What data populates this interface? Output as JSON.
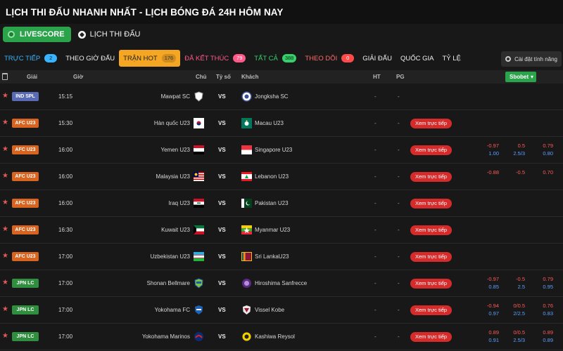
{
  "page": {
    "title": "LỊCH THI ĐẤU NHANH NHẤT - LỊCH BÓNG ĐÁ 24H HÔM NAY"
  },
  "modes": {
    "livescore": "LIVESCORE",
    "schedule": "LỊCH THI ĐẤU"
  },
  "filters": {
    "live": {
      "label": "TRỰC TIẾP",
      "count": "2"
    },
    "by_time": {
      "label": "THEO GIỜ ĐẤU"
    },
    "hot": {
      "label": "TRẬN HOT",
      "count": "176"
    },
    "finished": {
      "label": "ĐÃ KẾT THÚC",
      "count": "79"
    },
    "all": {
      "label": "TẤT CẢ",
      "count": "388"
    },
    "following": {
      "label": "THEO DÕI",
      "count": "0"
    },
    "league": {
      "label": "GIẢI ĐẤU"
    },
    "country": {
      "label": "QUỐC GIA"
    },
    "odds": {
      "label": "TỶ LỆ"
    },
    "settings": {
      "label": "Cài đặt tính năng"
    }
  },
  "table_header": {
    "league": "Giải",
    "time": "Giờ",
    "home": "Chủ",
    "score": "Tỷ số",
    "away": "Khách",
    "ht": "HT",
    "pg": "PG",
    "bookmaker": "Sbobet"
  },
  "live_button_label": "Xem trực tiếp",
  "colors": {
    "accent_green": "#2aa34a",
    "hot_orange": "#f5a623",
    "live_red": "#d62b2b",
    "odds_red": "#ff5a5a",
    "odds_blue": "#5aa0ff"
  },
  "matches": [
    {
      "league": "IND SPL",
      "league_color": "#5a6bb5",
      "time": "15:15",
      "home": "Mawpat SC",
      "home_logo": "shield-icon",
      "vs": "VS",
      "away": "Jongksha SC",
      "away_logo": "club-crest-icon",
      "ht": "-",
      "pg": "-",
      "live": false,
      "odds": null
    },
    {
      "league": "AFC U23",
      "league_color": "#d9641f",
      "time": "15:30",
      "home": "Hàn quốc U23",
      "home_logo": "korea-flag-icon",
      "vs": "VS",
      "away": "Macau U23",
      "away_logo": "macau-flag-icon",
      "ht": "-",
      "pg": "-",
      "live": true,
      "odds": null
    },
    {
      "league": "AFC U23",
      "league_color": "#d9641f",
      "time": "16:00",
      "home": "Yemen U23",
      "home_logo": "yemen-flag-icon",
      "vs": "VS",
      "away": "Singapore U23",
      "away_logo": "singapore-flag-icon",
      "ht": "-",
      "pg": "-",
      "live": true,
      "odds": {
        "a1": "-0.97",
        "a2": "1.00",
        "b1": "0.5",
        "b2": "2.5/3",
        "c1": "0.79",
        "c2": "0.80"
      }
    },
    {
      "league": "AFC U23",
      "league_color": "#d9641f",
      "time": "16:00",
      "home": "Malaysia U23",
      "home_logo": "malaysia-flag-icon",
      "vs": "VS",
      "away": "Lebanon U23",
      "away_logo": "lebanon-flag-icon",
      "ht": "-",
      "pg": "-",
      "live": true,
      "odds": {
        "a1": "-0.88",
        "a2": "",
        "b1": "-0.5",
        "b2": "",
        "c1": "0.70",
        "c2": ""
      }
    },
    {
      "league": "AFC U23",
      "league_color": "#d9641f",
      "time": "16:00",
      "home": "Iraq U23",
      "home_logo": "iraq-flag-icon",
      "vs": "VS",
      "away": "Pakistan U23",
      "away_logo": "pakistan-flag-icon",
      "ht": "-",
      "pg": "-",
      "live": true,
      "odds": null
    },
    {
      "league": "AFC U23",
      "league_color": "#d9641f",
      "time": "16:30",
      "home": "Kuwait U23",
      "home_logo": "kuwait-flag-icon",
      "vs": "VS",
      "away": "Myanmar U23",
      "away_logo": "myanmar-flag-icon",
      "ht": "-",
      "pg": "-",
      "live": true,
      "odds": null
    },
    {
      "league": "AFC U23",
      "league_color": "#d9641f",
      "time": "17:00",
      "home": "Uzbekistan U23",
      "home_logo": "uzbekistan-flag-icon",
      "vs": "VS",
      "away": "Sri LankaU23",
      "away_logo": "sri-lanka-flag-icon",
      "ht": "-",
      "pg": "-",
      "live": true,
      "odds": null
    },
    {
      "league": "JPN LC",
      "league_color": "#2f8f3e",
      "time": "17:00",
      "home": "Shonan Bellmare",
      "home_logo": "shonan-crest-icon",
      "vs": "VS",
      "away": "Hiroshima Sanfrecce",
      "away_logo": "hiroshima-crest-icon",
      "ht": "-",
      "pg": "-",
      "live": true,
      "odds": {
        "a1": "-0.97",
        "a2": "0.85",
        "b1": "-0.5",
        "b2": "2.5",
        "c1": "0.79",
        "c2": "0.95"
      }
    },
    {
      "league": "JPN LC",
      "league_color": "#2f8f3e",
      "time": "17:00",
      "home": "Yokohama FC",
      "home_logo": "yokohama-fc-crest-icon",
      "vs": "VS",
      "away": "Vissel Kobe",
      "away_logo": "vissel-crest-icon",
      "ht": "-",
      "pg": "-",
      "live": true,
      "odds": {
        "a1": "-0.94",
        "a2": "0.97",
        "b1": "0/0.5",
        "b2": "2/2.5",
        "c1": "0.76",
        "c2": "0.83"
      }
    },
    {
      "league": "JPN LC",
      "league_color": "#2f8f3e",
      "time": "17:00",
      "home": "Yokohama Marinos",
      "home_logo": "marinos-crest-icon",
      "vs": "VS",
      "away": "Kashiwa Reysol",
      "away_logo": "kashiwa-crest-icon",
      "ht": "-",
      "pg": "-",
      "live": true,
      "odds": {
        "a1": "0.89",
        "a2": "0.91",
        "b1": "0/0.5",
        "b2": "2.5/3",
        "c1": "0.89",
        "c2": "0.89"
      }
    }
  ]
}
